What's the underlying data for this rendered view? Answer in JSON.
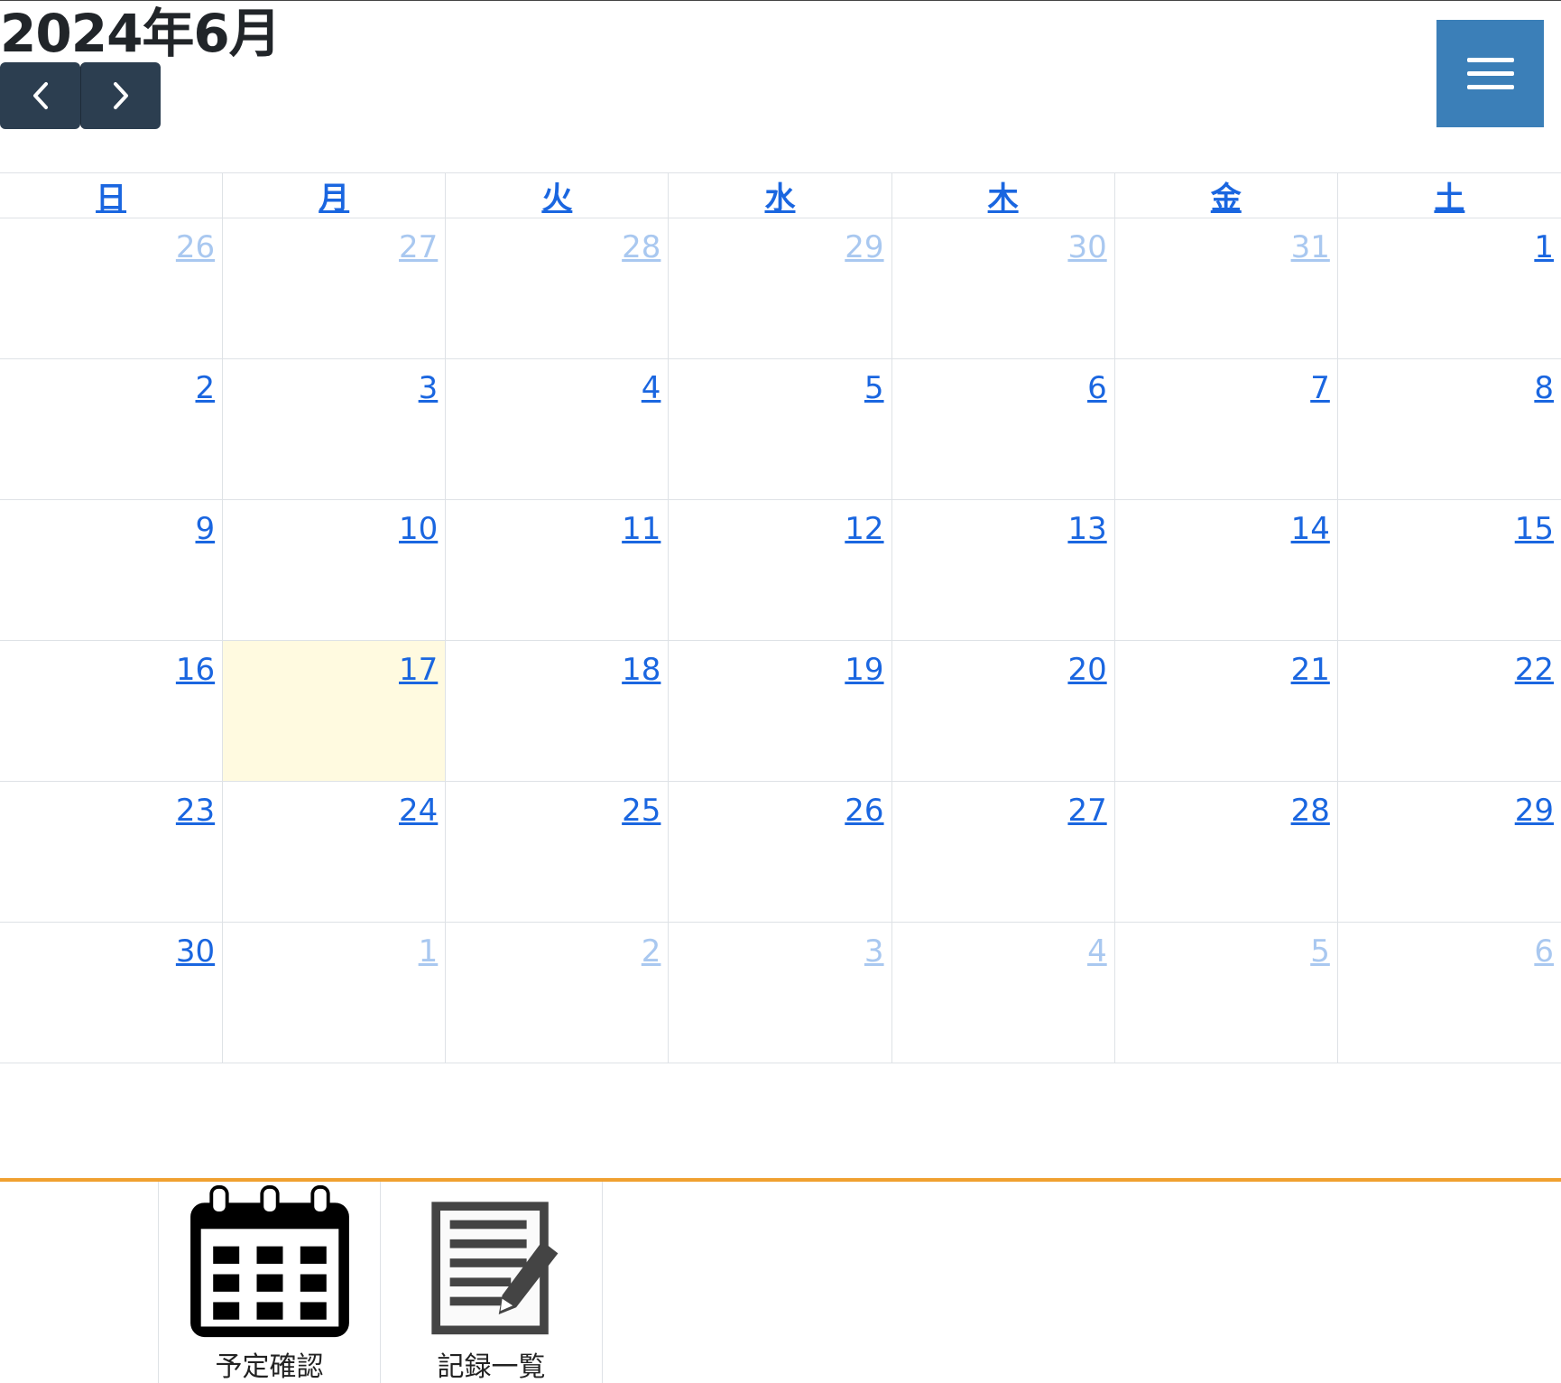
{
  "header": {
    "title": "2024年6月",
    "prev_icon": "chevron-left-icon",
    "next_icon": "chevron-right-icon",
    "menu_icon": "hamburger-menu-icon",
    "menu_color": "#3b7fb8",
    "nav_color": "#2c3e50"
  },
  "calendar": {
    "weekdays": [
      "日",
      "月",
      "火",
      "水",
      "木",
      "金",
      "土"
    ],
    "weeks": [
      [
        {
          "d": "26",
          "other": true
        },
        {
          "d": "27",
          "other": true
        },
        {
          "d": "28",
          "other": true
        },
        {
          "d": "29",
          "other": true
        },
        {
          "d": "30",
          "other": true
        },
        {
          "d": "31",
          "other": true
        },
        {
          "d": "1",
          "other": false
        }
      ],
      [
        {
          "d": "2",
          "other": false
        },
        {
          "d": "3",
          "other": false
        },
        {
          "d": "4",
          "other": false
        },
        {
          "d": "5",
          "other": false
        },
        {
          "d": "6",
          "other": false
        },
        {
          "d": "7",
          "other": false
        },
        {
          "d": "8",
          "other": false
        }
      ],
      [
        {
          "d": "9",
          "other": false
        },
        {
          "d": "10",
          "other": false
        },
        {
          "d": "11",
          "other": false
        },
        {
          "d": "12",
          "other": false
        },
        {
          "d": "13",
          "other": false
        },
        {
          "d": "14",
          "other": false
        },
        {
          "d": "15",
          "other": false
        }
      ],
      [
        {
          "d": "16",
          "other": false
        },
        {
          "d": "17",
          "other": false,
          "today": true
        },
        {
          "d": "18",
          "other": false
        },
        {
          "d": "19",
          "other": false
        },
        {
          "d": "20",
          "other": false
        },
        {
          "d": "21",
          "other": false
        },
        {
          "d": "22",
          "other": false
        }
      ],
      [
        {
          "d": "23",
          "other": false
        },
        {
          "d": "24",
          "other": false
        },
        {
          "d": "25",
          "other": false
        },
        {
          "d": "26",
          "other": false
        },
        {
          "d": "27",
          "other": false
        },
        {
          "d": "28",
          "other": false
        },
        {
          "d": "29",
          "other": false
        }
      ],
      [
        {
          "d": "30",
          "other": false
        },
        {
          "d": "1",
          "other": true
        },
        {
          "d": "2",
          "other": true
        },
        {
          "d": "3",
          "other": true
        },
        {
          "d": "4",
          "other": true
        },
        {
          "d": "5",
          "other": true
        },
        {
          "d": "6",
          "other": true
        }
      ]
    ],
    "today_color": "#fffae0",
    "link_color": "#1a66e0"
  },
  "footer": {
    "accent_color": "#f0a030",
    "items": [
      {
        "label": "予定確認",
        "icon": "calendar-icon"
      },
      {
        "label": "記録一覧",
        "icon": "notepad-pencil-icon"
      }
    ]
  }
}
